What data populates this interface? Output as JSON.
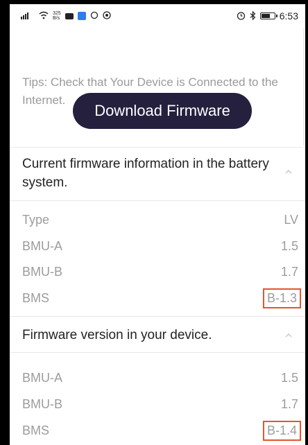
{
  "status_bar": {
    "signal_label": "4G",
    "speed_value": "325",
    "speed_unit": "B/s",
    "time": "6:53"
  },
  "tips": {
    "text": "Tips: Check that Your Device is Connected to the Internet.",
    "download_button": "Download Firmware"
  },
  "current_section": {
    "title": "Current firmware information in the battery system.",
    "rows": [
      {
        "label": "Type",
        "value": "LV"
      },
      {
        "label": "BMU-A",
        "value": "1.5"
      },
      {
        "label": "BMU-B",
        "value": "1.7"
      },
      {
        "label": "BMS",
        "value": "B-1.3"
      }
    ]
  },
  "device_section": {
    "title": "Firmware version in your device.",
    "rows": [
      {
        "label": "BMU-A",
        "value": "1.5"
      },
      {
        "label": "BMU-B",
        "value": "1.7"
      },
      {
        "label": "BMS",
        "value": "B-1.4"
      }
    ]
  },
  "colors": {
    "button_bg": "#26203f",
    "highlight_border": "#e2552f",
    "muted_text": "#9c9c9c"
  }
}
